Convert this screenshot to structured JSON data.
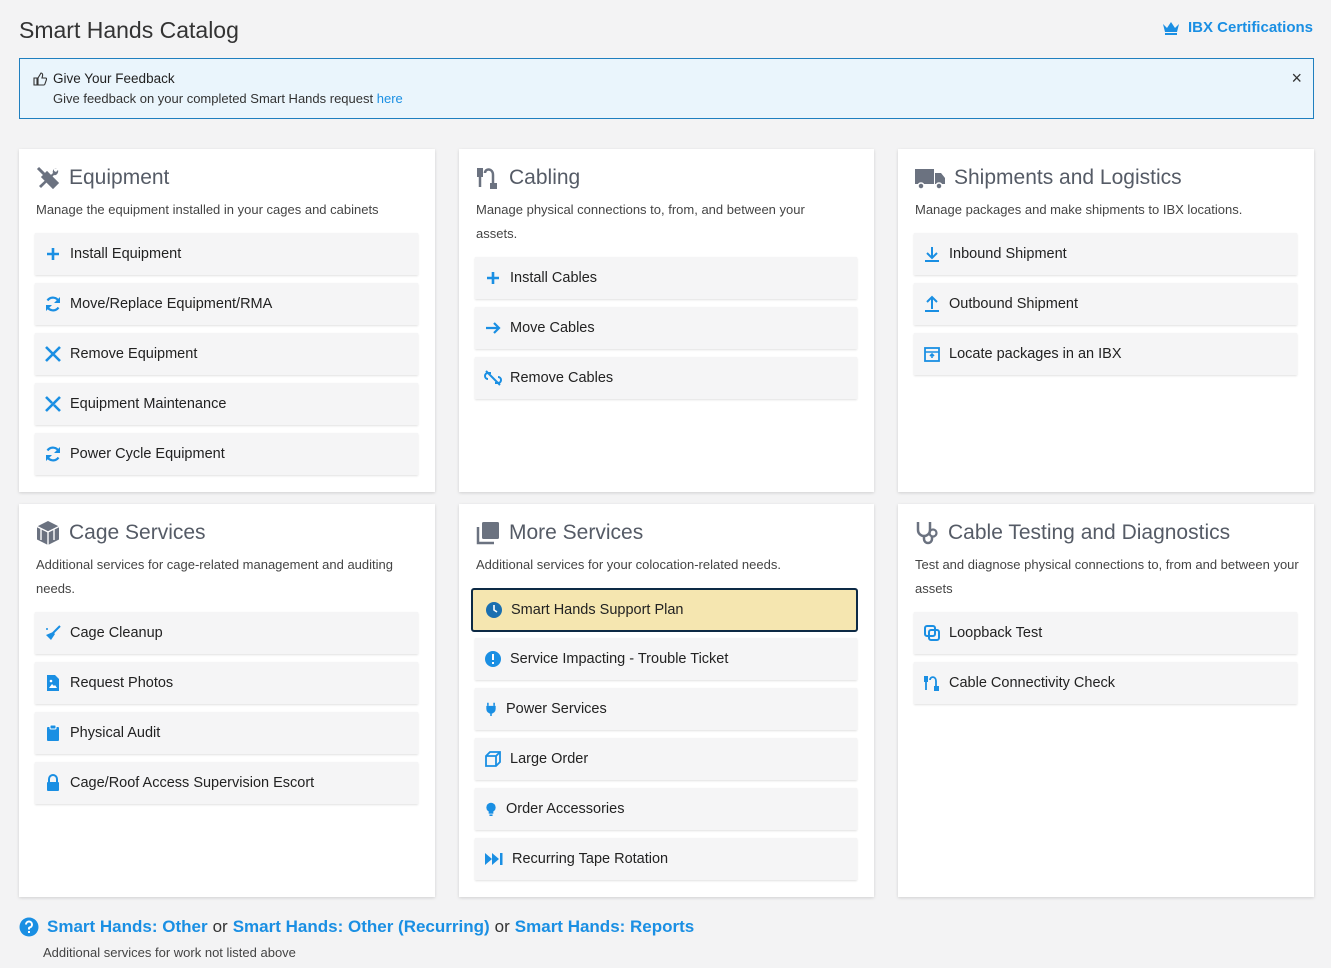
{
  "header": {
    "title": "Smart Hands Catalog",
    "ibx_link": "IBX Certifications"
  },
  "feedback": {
    "title": "Give Your Feedback",
    "text": "Give feedback on your completed Smart Hands request",
    "link": "here",
    "close": "×"
  },
  "cards": {
    "equipment": {
      "title": "Equipment",
      "desc": "Manage the equipment installed in your cages and cabinets",
      "items": [
        "Install Equipment",
        "Move/Replace Equipment/RMA",
        "Remove Equipment",
        "Equipment Maintenance",
        "Power Cycle Equipment"
      ]
    },
    "cabling": {
      "title": "Cabling",
      "desc": "Manage physical connections to, from, and between your assets.",
      "items": [
        "Install Cables",
        "Move Cables",
        "Remove Cables"
      ]
    },
    "shipments": {
      "title": "Shipments and Logistics",
      "desc": "Manage packages and make shipments to IBX locations.",
      "items": [
        "Inbound Shipment",
        "Outbound Shipment",
        "Locate packages in an IBX"
      ]
    },
    "cage": {
      "title": "Cage Services",
      "desc": "Additional services for cage-related management and auditing needs.",
      "items": [
        "Cage Cleanup",
        "Request Photos",
        "Physical Audit",
        "Cage/Roof Access Supervision Escort"
      ]
    },
    "more": {
      "title": "More Services",
      "desc": "Additional services for your colocation-related needs.",
      "items": [
        "Smart Hands Support Plan",
        "Service Impacting - Trouble Ticket",
        "Power Services",
        "Large Order",
        "Order Accessories",
        "Recurring Tape Rotation"
      ]
    },
    "testing": {
      "title": "Cable Testing and Diagnostics",
      "desc": "Test and diagnose physical connections to, from and between your assets",
      "items": [
        "Loopback Test",
        "Cable Connectivity Check"
      ]
    }
  },
  "footer": {
    "link1": "Smart Hands: Other",
    "or1": "or",
    "link2": "Smart Hands: Other (Recurring)",
    "or2": "or",
    "link3": "Smart Hands: Reports",
    "desc": "Additional services for work not listed above"
  },
  "colors": {
    "accent": "#1a8fe3",
    "highlight_bg": "#f5e6b0",
    "highlight_border": "#0d2a45",
    "heading_icon": "#6b7280"
  }
}
